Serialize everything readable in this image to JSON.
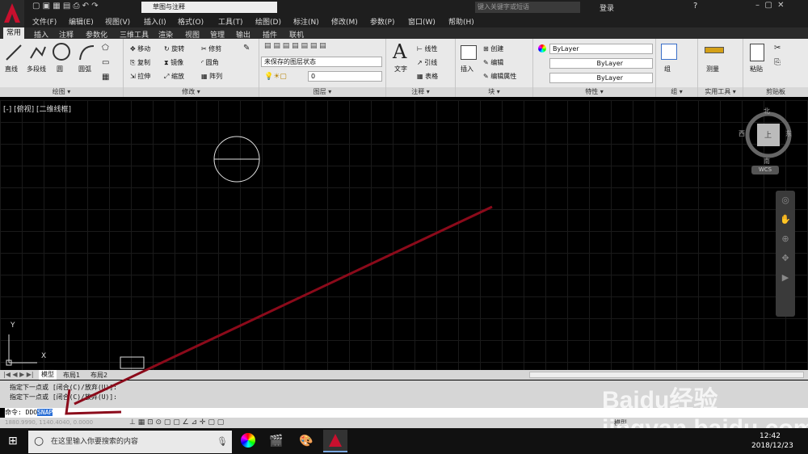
{
  "title_bar": {
    "workspace": "草图与注释",
    "search_placeholder": "键入关键字或短语",
    "login": "登录"
  },
  "menu": [
    "文件(F)",
    "编辑(E)",
    "视图(V)",
    "插入(I)",
    "格式(O)",
    "工具(T)",
    "绘图(D)",
    "标注(N)",
    "修改(M)",
    "参数(P)",
    "窗口(W)",
    "帮助(H)"
  ],
  "tabs": [
    "常用",
    "插入",
    "注释",
    "参数化",
    "三维工具",
    "渲染",
    "视图",
    "管理",
    "输出",
    "插件",
    "联机"
  ],
  "ribbon": {
    "draw": {
      "title": "绘图 ▾",
      "line": "直线",
      "polyline": "多段线",
      "circle": "圆",
      "arc": "圆弧"
    },
    "modify": {
      "title": "修改 ▾",
      "move": "移动",
      "rotate": "旋转",
      "trim": "修剪",
      "copy": "复制",
      "mirror": "镜像",
      "fillet": "圆角",
      "stretch": "拉伸",
      "scale": "缩放",
      "array": "阵列"
    },
    "layers": {
      "title": "图层 ▾",
      "layer_state": "未保存的图层状态",
      "layer_current": "0"
    },
    "annotation": {
      "title": "注释 ▾",
      "text": "文字",
      "linear": "线性",
      "leader": "引线",
      "table": "表格"
    },
    "block": {
      "title": "块 ▾",
      "insert": "插入",
      "create": "创建",
      "edit": "编辑",
      "edit_attr": "编辑属性"
    },
    "properties": {
      "title": "特性 ▾",
      "color": "ByLayer",
      "linetype": "ByLayer",
      "lineweight": "ByLayer"
    },
    "groups": {
      "title": "组 ▾",
      "group": "组"
    },
    "utilities": {
      "title": "实用工具 ▾",
      "measure": "测量"
    },
    "clipboard": {
      "title": "剪贴板",
      "paste": "粘贴"
    }
  },
  "viewport": {
    "label": "[-] [俯视] [二维线框]",
    "compass_n": "北",
    "compass_s": "南",
    "compass_e": "东",
    "compass_w": "西",
    "compass_top": "上",
    "wcs": "WCS",
    "axis_y": "Y",
    "axis_x": "X"
  },
  "layout_tabs": [
    "模型",
    "布局1",
    "布局2"
  ],
  "command": {
    "history": [
      "指定下一点或 [闭合(C)/放弃(U)]:",
      "指定下一点或 [闭合(C)/放弃(U)]:"
    ],
    "prompt": "命令:",
    "typed": "DDO",
    "selected": "SNAP"
  },
  "status": {
    "coords": "1880.9990, 1140.4040, 0.0000",
    "model": "模型"
  },
  "taskbar": {
    "search": "在这里输入你要搜索的内容",
    "time": "12:42",
    "date": "2018/12/23"
  },
  "watermark": "Baidu经验 jingyan.baidu.com",
  "colors": {
    "accent": "#c8102e",
    "arrow": "#8b0a1a",
    "selection": "#2a6fd6"
  }
}
